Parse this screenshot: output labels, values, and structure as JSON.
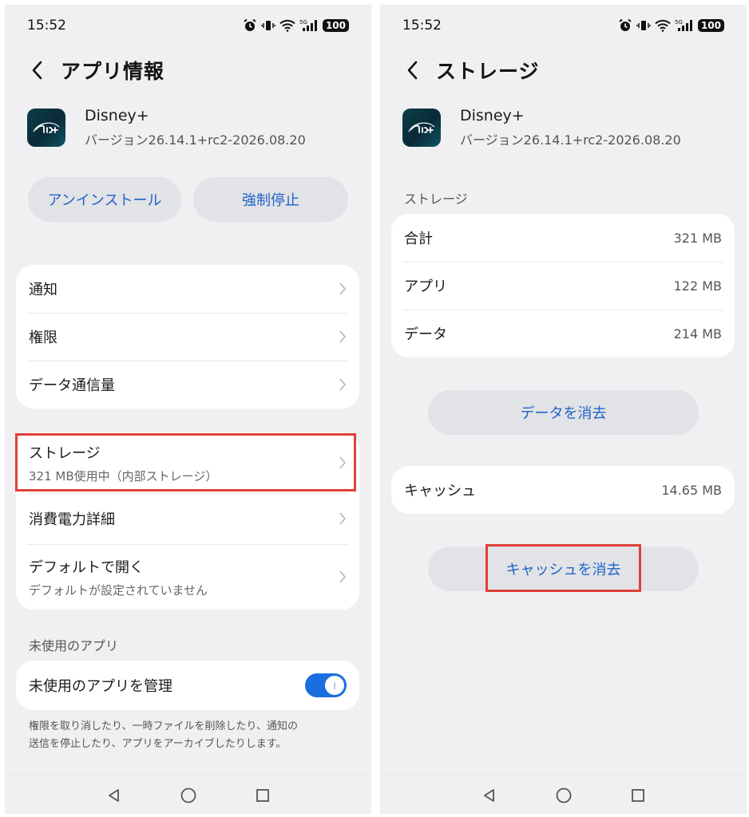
{
  "status": {
    "time": "15:52",
    "battery": "100"
  },
  "left": {
    "title": "アプリ情報",
    "app": {
      "name": "Disney+",
      "version": "バージョン26.14.1+rc2-2026.08.20"
    },
    "buttons": {
      "uninstall": "アンインストール",
      "force_stop": "強制停止"
    },
    "menu1": [
      "通知",
      "権限",
      "データ通信量"
    ],
    "storage": {
      "label": "ストレージ",
      "sub": "321 MB使用中（内部ストレージ）"
    },
    "power": "消費電力詳細",
    "default_open": {
      "label": "デフォルトで開く",
      "sub": "デフォルトが設定されていません"
    },
    "unused_section": "未使用のアプリ",
    "unused_manage": "未使用のアプリを管理",
    "unused_enabled": true,
    "footnote": [
      "権限を取り消したり、一時ファイルを削除したり、通知の",
      "送信を停止したり、アプリをアーカイブしたりします。"
    ]
  },
  "right": {
    "title": "ストレージ",
    "app": {
      "name": "Disney+",
      "version": "バージョン26.14.1+rc2-2026.08.20"
    },
    "section": "ストレージ",
    "rows": [
      {
        "label": "合計",
        "value": "321 MB"
      },
      {
        "label": "アプリ",
        "value": "122 MB"
      },
      {
        "label": "データ",
        "value": "214 MB"
      }
    ],
    "clear_data": "データを消去",
    "cache": {
      "label": "キャッシュ",
      "value": "14.65 MB"
    },
    "clear_cache": "キャッシュを消去"
  },
  "colors": {
    "accent": "#1f62c9",
    "toggle": "#1a6fe0",
    "highlight": "#e0403a",
    "background": "#f0f0f2"
  }
}
